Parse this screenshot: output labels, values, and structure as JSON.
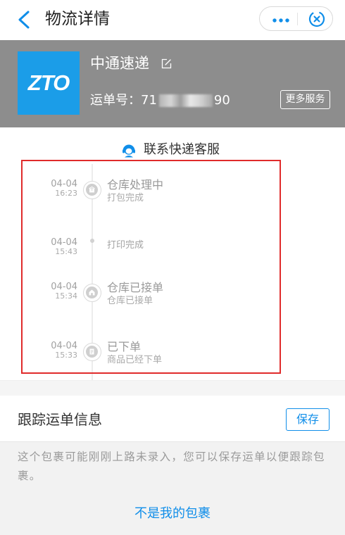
{
  "nav": {
    "title": "物流详情",
    "back_icon": "chevron-left-icon",
    "more_icon": "more-dots-icon",
    "close_icon": "close-circle-icon"
  },
  "carrier": {
    "logo_text": "ZTO",
    "name": "中通速递",
    "edit_icon": "edit-icon",
    "waybill_label": "运单号：",
    "waybill_start": "71",
    "waybill_end": "90",
    "more_services_label": "更多服务"
  },
  "contact": {
    "icon": "customer-service-icon",
    "label": "联系快递客服"
  },
  "timeline": [
    {
      "date": "04-04",
      "time": "16:23",
      "status": "仓库处理中",
      "detail": "打包完成",
      "marker": "package-icon"
    },
    {
      "date": "04-04",
      "time": "15:43",
      "detail": "打印完成",
      "marker": "dot"
    },
    {
      "date": "04-04",
      "time": "15:34",
      "status": "仓库已接单",
      "detail": "仓库已接单",
      "marker": "warehouse-icon"
    },
    {
      "date": "04-04",
      "time": "15:33",
      "status": "已下单",
      "detail": "商品已经下单",
      "marker": "order-icon"
    }
  ],
  "tracking": {
    "title": "跟踪运单信息",
    "save_label": "保存",
    "note": "这个包裹可能刚刚上路未录入，您可以保存运单以便跟踪包裹。",
    "not_mine_label": "不是我的包裹"
  },
  "colors": {
    "accent": "#108ee9",
    "brand": "#1b9de8",
    "band": "#8d8d8d",
    "annotation": "#e02b2b",
    "page_gray": "#f2f2f2"
  }
}
